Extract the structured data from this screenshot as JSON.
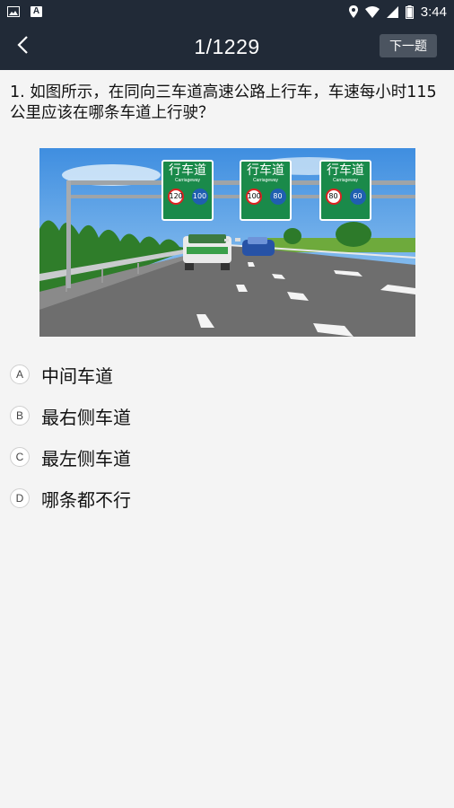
{
  "status_bar": {
    "time": "3:44",
    "notif_a": "A",
    "icons": [
      "image-icon",
      "a-icon",
      "location-icon",
      "wifi-icon",
      "signal-icon",
      "battery-icon"
    ]
  },
  "header": {
    "title": "1/1229",
    "next_label": "下一题",
    "back_icon": "chevron-left-icon"
  },
  "question": {
    "text": "1. 如图所示，在同向三车道高速公路上行车，车速每小时115公里应该在哪条车道上行驶？"
  },
  "figure": {
    "signs": [
      {
        "title": "行车道",
        "subtitle": "Carriageway",
        "limits": [
          "120",
          "100"
        ]
      },
      {
        "title": "行车道",
        "subtitle": "Carriageway",
        "limits": [
          "100",
          "80"
        ]
      },
      {
        "title": "行车道",
        "subtitle": "Carriageway",
        "limits": [
          "80",
          "60"
        ]
      }
    ]
  },
  "options": [
    {
      "letter": "A",
      "text": "中间车道"
    },
    {
      "letter": "B",
      "text": "最右侧车道"
    },
    {
      "letter": "C",
      "text": "最左侧车道"
    },
    {
      "letter": "D",
      "text": "哪条都不行"
    }
  ],
  "colors": {
    "header_bg": "#212a37",
    "sign_green": "#1a8a4a",
    "background": "#f4f4f4"
  }
}
